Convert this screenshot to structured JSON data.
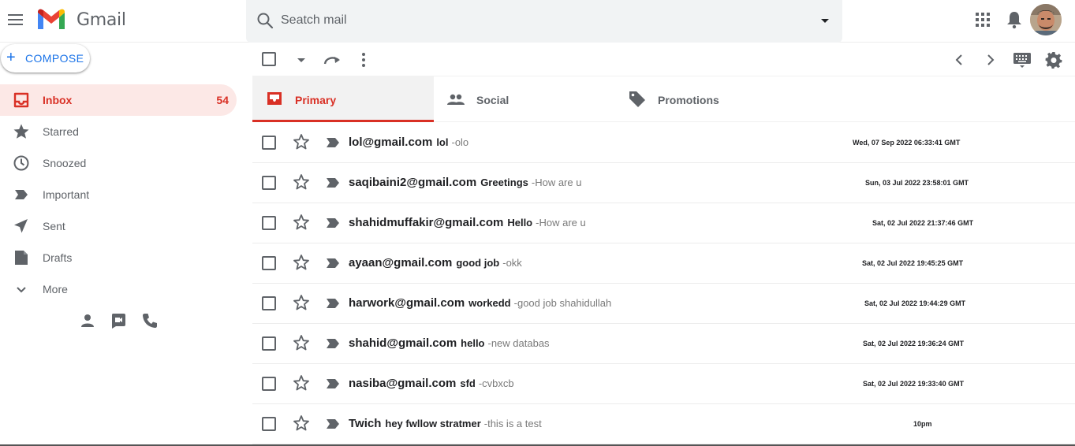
{
  "header": {
    "app_name": "Gmail",
    "search_placeholder": "Seatch mail",
    "icons": [
      "menu-icon",
      "gmail-logo",
      "search-icon",
      "dropdown-icon",
      "apps-icon",
      "notifications-icon",
      "avatar"
    ]
  },
  "sidebar": {
    "compose_label": "COMPOSE",
    "items": [
      {
        "label": "Inbox",
        "count": "54",
        "icon": "inbox-icon",
        "active": true
      },
      {
        "label": "Starred",
        "count": "",
        "icon": "star-icon",
        "active": false
      },
      {
        "label": "Snoozed",
        "count": "",
        "icon": "clock-icon",
        "active": false
      },
      {
        "label": "Important",
        "count": "",
        "icon": "important-icon",
        "active": false
      },
      {
        "label": "Sent",
        "count": "",
        "icon": "send-icon",
        "active": false
      },
      {
        "label": "Drafts",
        "count": "",
        "icon": "draft-icon",
        "active": false
      },
      {
        "label": "More",
        "count": "",
        "icon": "chevron-down-icon",
        "active": false
      }
    ]
  },
  "tabs": [
    {
      "label": "Primary",
      "icon": "inbox-icon",
      "active": true
    },
    {
      "label": "Social",
      "icon": "people-icon",
      "active": false
    },
    {
      "label": "Promotions",
      "icon": "tag-icon",
      "active": false
    }
  ],
  "emails": [
    {
      "sender": "lol@gmail.com",
      "subject": "lol",
      "snippet": "-olo",
      "date": "Wed, 07 Sep 2022 06:33:41 GMT"
    },
    {
      "sender": "saqibaini2@gmail.com",
      "subject": "Greetings",
      "snippet": "-How are u",
      "date": "Sun, 03 Jul 2022 23:58:01 GMT"
    },
    {
      "sender": "shahidmuffakir@gmail.com",
      "subject": "Hello",
      "snippet": "-How are u",
      "date": "Sat, 02 Jul 2022 21:37:46 GMT"
    },
    {
      "sender": "ayaan@gmail.com",
      "subject": "good job",
      "snippet": "-okk",
      "date": "Sat, 02 Jul 2022 19:45:25 GMT"
    },
    {
      "sender": "harwork@gmail.com",
      "subject": "workedd",
      "snippet": "-good job shahidullah",
      "date": "Sat, 02 Jul 2022 19:44:29 GMT"
    },
    {
      "sender": "shahid@gmail.com",
      "subject": "hello",
      "snippet": "-new databas",
      "date": "Sat, 02 Jul 2022 19:36:24 GMT"
    },
    {
      "sender": "nasiba@gmail.com",
      "subject": "sfd",
      "snippet": "-cvbxcb",
      "date": "Sat, 02 Jul 2022 19:33:40 GMT"
    },
    {
      "sender": "Twich",
      "subject": "hey fwllow stratmer",
      "snippet": "-this is a test",
      "date": "10pm"
    }
  ],
  "colors": {
    "accent_red": "#d93025",
    "compose_blue": "#1a73e8",
    "search_bg": "#f1f3f4",
    "active_nav_bg": "#fce8e6"
  }
}
